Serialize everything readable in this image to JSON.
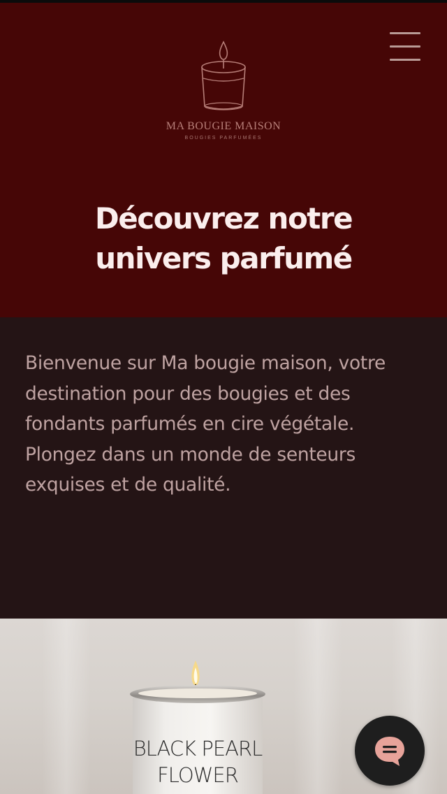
{
  "brand": {
    "name": "MA BOUGIE MAISON",
    "tagline": "BOUGIES PARFUMÉES",
    "logo_icon": "candle-icon"
  },
  "header": {
    "menu_icon": "hamburger-menu-icon",
    "headline_line1": "Découvrez notre",
    "headline_line2": "univers parfumé"
  },
  "intro": {
    "text": "Bienvenue sur Ma bougie maison, votre destination pour des bougies et des fondants parfumés en cire végétale. Plongez dans un monde de senteurs exquises et de qualité."
  },
  "photo": {
    "label_line1": "BLACK PEARL",
    "label_line2": "FLOWER"
  },
  "chat": {
    "icon": "chat-bubble-icon"
  },
  "colors": {
    "header_bg": "#460606",
    "intro_bg": "#241415",
    "headline": "#fbeeed",
    "body_text": "#bfa3a2",
    "logo": "#b77f79",
    "chat_accent": "#e7a39a"
  }
}
